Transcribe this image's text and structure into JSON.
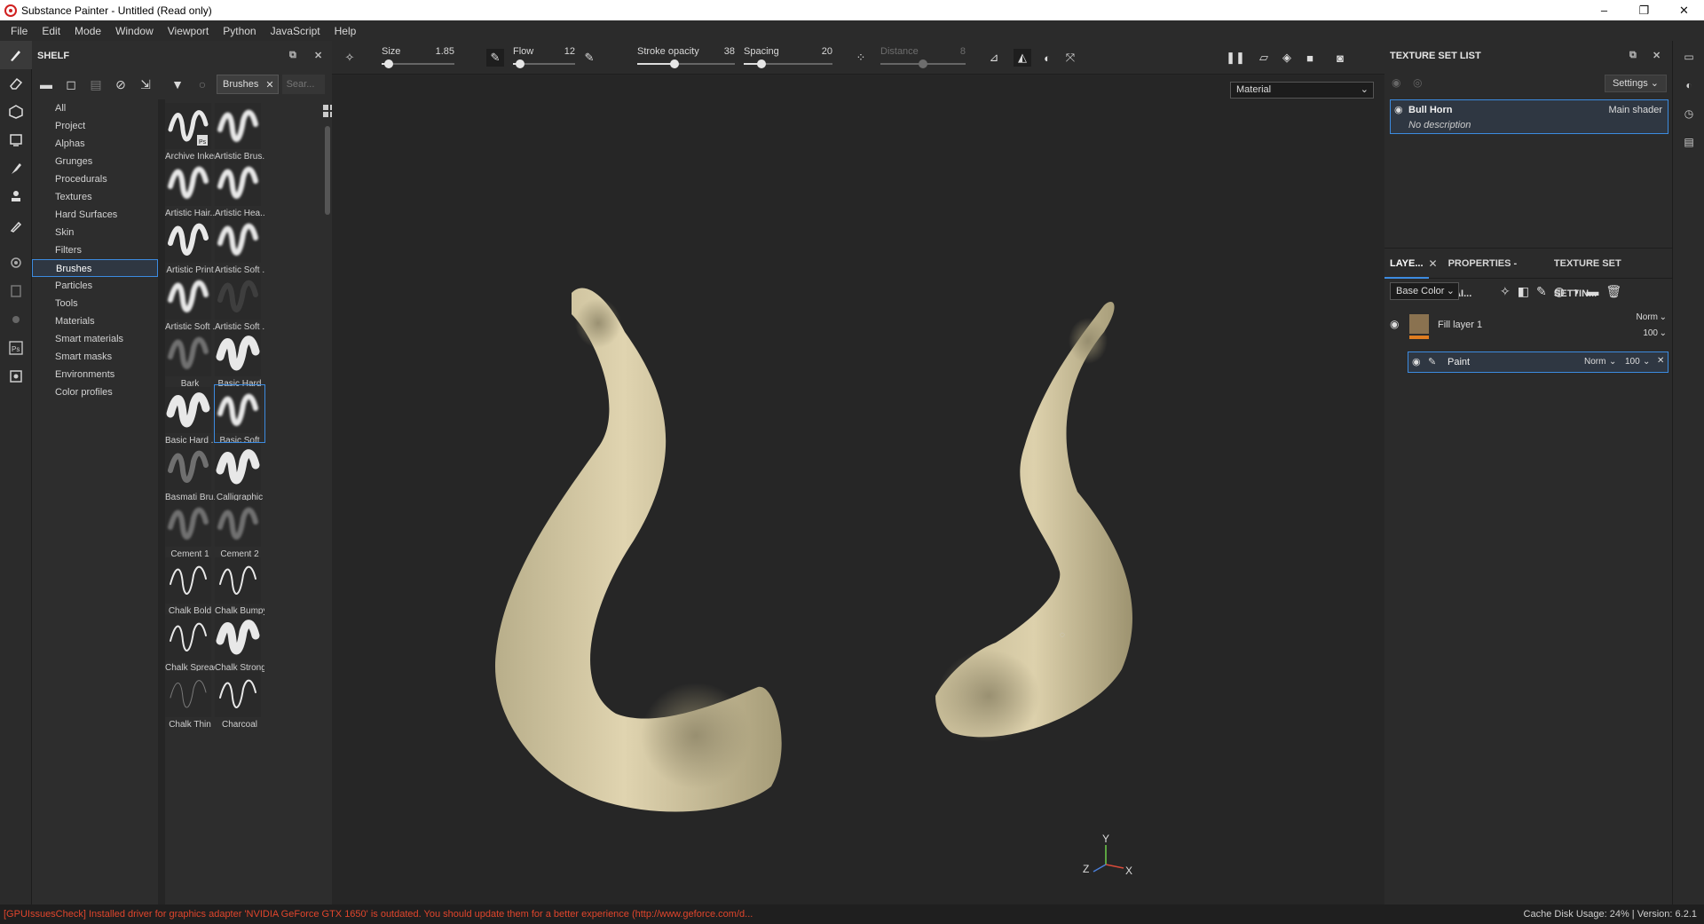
{
  "window": {
    "title": "Substance Painter - Untitled (Read only)",
    "controls": [
      "–",
      "❐",
      "✕"
    ]
  },
  "menu": [
    "File",
    "Edit",
    "Mode",
    "Window",
    "Viewport",
    "Python",
    "JavaScript",
    "Help"
  ],
  "shelf": {
    "title": "SHELF",
    "filter_tag": "Brushes",
    "search_placeholder": "Sear...",
    "categories": [
      "All",
      "Project",
      "Alphas",
      "Grunges",
      "Procedurals",
      "Textures",
      "Hard Surfaces",
      "Skin",
      "Filters",
      "Brushes",
      "Particles",
      "Tools",
      "Materials",
      "Smart materials",
      "Smart masks",
      "Environments",
      "Color profiles"
    ],
    "active_category": "Brushes",
    "brushes": [
      "Archive Inker",
      "Artistic Brus...",
      "Artistic Hair...",
      "Artistic Hea...",
      "Artistic Print",
      "Artistic Soft ...",
      "Artistic Soft ...",
      "Artistic Soft ...",
      "Bark",
      "Basic Hard",
      "Basic Hard ...",
      "Basic Soft",
      "Basmati Bru...",
      "Calligraphic",
      "Cement 1",
      "Cement 2",
      "Chalk Bold",
      "Chalk Bumpy",
      "Chalk Spread",
      "Chalk Strong",
      "Chalk Thin",
      "Charcoal"
    ],
    "selected_brush": "Basic Soft"
  },
  "toolbar": {
    "size": {
      "label": "Size",
      "value": "1.85",
      "fraction": 0.1
    },
    "flow": {
      "label": "Flow",
      "value": "12",
      "fraction": 0.12
    },
    "stroke_opacity": {
      "label": "Stroke opacity",
      "value": "38",
      "fraction": 0.38
    },
    "spacing": {
      "label": "Spacing",
      "value": "20",
      "fraction": 0.2
    },
    "distance": {
      "label": "Distance",
      "value": "8",
      "fraction": 0.5
    }
  },
  "viewport": {
    "mode_select": "Material",
    "axis": {
      "x": "X",
      "y": "Y",
      "z": "Z"
    }
  },
  "texture_set_list": {
    "title": "TEXTURE SET LIST",
    "settings_label": "Settings",
    "item_name": "Bull Horn",
    "item_shader": "Main shader",
    "item_description": "No description"
  },
  "layers": {
    "tabs": [
      "LAYE...",
      "PROPERTIES - PAI...",
      "TEXTURE SET SETTIN..."
    ],
    "channel_select": "Base Color",
    "fill_layer": {
      "name": "Fill layer 1",
      "blend": "Norm",
      "opacity": "100"
    },
    "paint_layer": {
      "name": "Paint",
      "blend": "Norm",
      "opacity": "100"
    }
  },
  "status": {
    "error": "[GPUIssuesCheck] Installed driver for graphics adapter 'NVIDIA GeForce GTX 1650' is outdated. You should update them for a better experience (http://www.geforce.com/d...",
    "cache": "Cache Disk Usage:   24% | Version: 6.2.1"
  },
  "colors": {
    "accent": "#3c8be0",
    "horn": "#d7cba6",
    "error": "#e0452c"
  }
}
